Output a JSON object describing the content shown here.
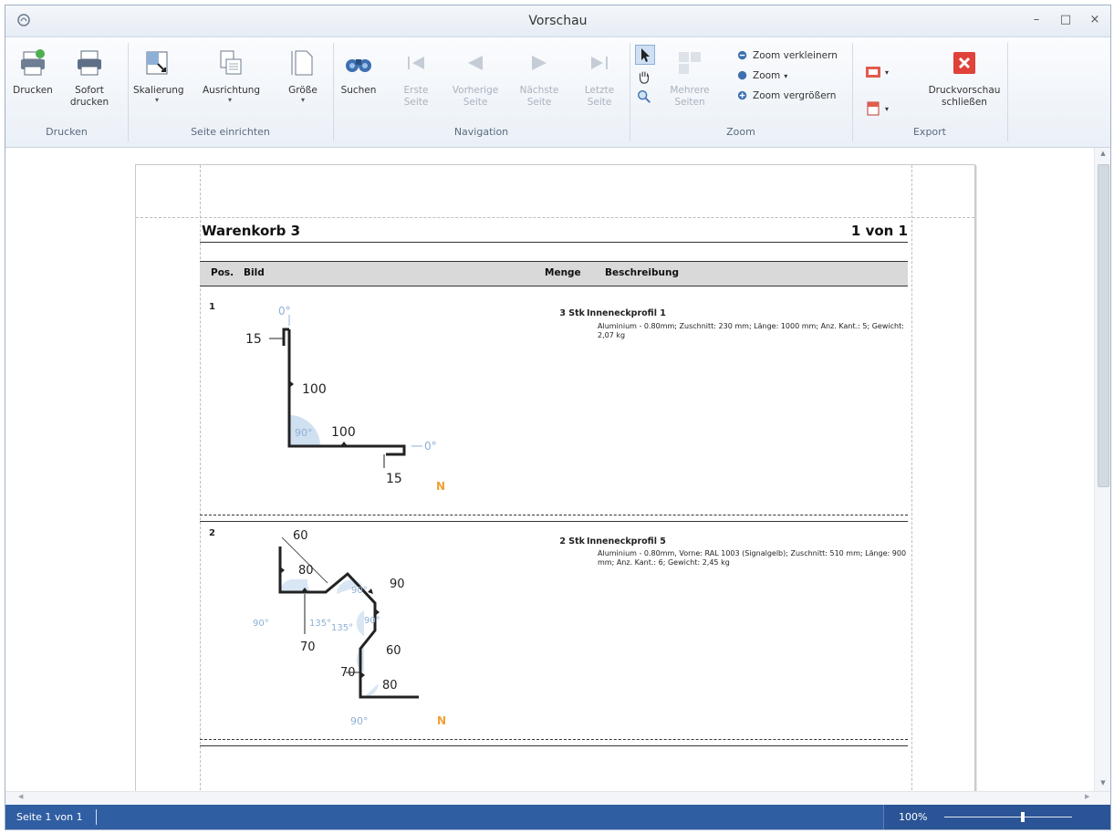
{
  "window": {
    "title": "Vorschau",
    "controls": {
      "minimize": "–",
      "maximize": "□",
      "close": "×"
    }
  },
  "ribbon": {
    "groups": [
      {
        "label": "Drucken",
        "buttons": [
          {
            "label": "Drucken",
            "icon": "printer-icon"
          },
          {
            "label": "Sofort\ndrucken",
            "icon": "printer-icon"
          }
        ]
      },
      {
        "label": "Seite einrichten",
        "buttons": [
          {
            "label": "Skalierung",
            "icon": "scale-icon"
          },
          {
            "label": "Ausrichtung",
            "icon": "orientation-icon"
          },
          {
            "label": "Größe",
            "icon": "page-size-icon"
          }
        ]
      },
      {
        "label": "Navigation",
        "buttons": [
          {
            "label": "Suchen",
            "icon": "binoculars-icon"
          },
          {
            "label": "Erste\nSeite",
            "icon": "first-page-icon",
            "disabled": true
          },
          {
            "label": "Vorherige\nSeite",
            "icon": "previous-page-icon",
            "disabled": true
          },
          {
            "label": "Nächste\nSeite",
            "icon": "next-page-icon",
            "disabled": true
          },
          {
            "label": "Letzte\nSeite",
            "icon": "last-page-icon",
            "disabled": true
          }
        ]
      },
      {
        "label": "Zoom",
        "buttons": [
          {
            "label": "Mehrere\nSeiten",
            "icon": "multiple-pages-icon",
            "disabled": true
          },
          {
            "label": "Zoom verkleinern",
            "icon": "zoom-out-icon"
          },
          {
            "label": "Zoom",
            "icon": "zoom-icon"
          },
          {
            "label": "Zoom vergrößern",
            "icon": "zoom-in-icon"
          }
        ]
      },
      {
        "label": "Export",
        "buttons": [
          {
            "label": "Druckvorschau\nschließen",
            "icon": "close-preview-icon"
          }
        ]
      }
    ],
    "colors": {
      "close_red": "#e0413a",
      "accent_blue": "#2f5ea3"
    }
  },
  "report": {
    "title": "Warenkorb 3",
    "page_counter": "1 von 1",
    "columns": {
      "pos": "Pos.",
      "image": "Bild",
      "qty": "Menge",
      "desc": "Beschreibung"
    },
    "items": [
      {
        "pos": "1",
        "qty": "3 Stk",
        "name": "Inneneckprofil 1",
        "details": "Aluminium - 0.80mm; Zuschnitt: 230 mm; Länge: 1000 mm; Anz. Kant.: 5; Gewicht: 2,07 kg",
        "drawing": {
          "labels": [
            "0°",
            "15",
            "100",
            "90°",
            "100",
            "0°",
            "15",
            "N"
          ]
        }
      },
      {
        "pos": "2",
        "qty": "2 Stk",
        "name": "Inneneckprofil 5",
        "details": "Aluminium - 0.80mm, Vorne: RAL 1003 (Signalgelb); Zuschnitt: 510 mm; Länge: 900 mm; Anz. Kant.: 6; Gewicht: 2,45 kg",
        "drawing": {
          "labels": [
            "60",
            "80",
            "90",
            "90°",
            "90°",
            "135°",
            "135°",
            "90°",
            "60",
            "70",
            "70",
            "80",
            "90°",
            "N"
          ]
        }
      }
    ]
  },
  "statusbar": {
    "page_info": "Seite 1 von 1",
    "zoom": "100%"
  }
}
